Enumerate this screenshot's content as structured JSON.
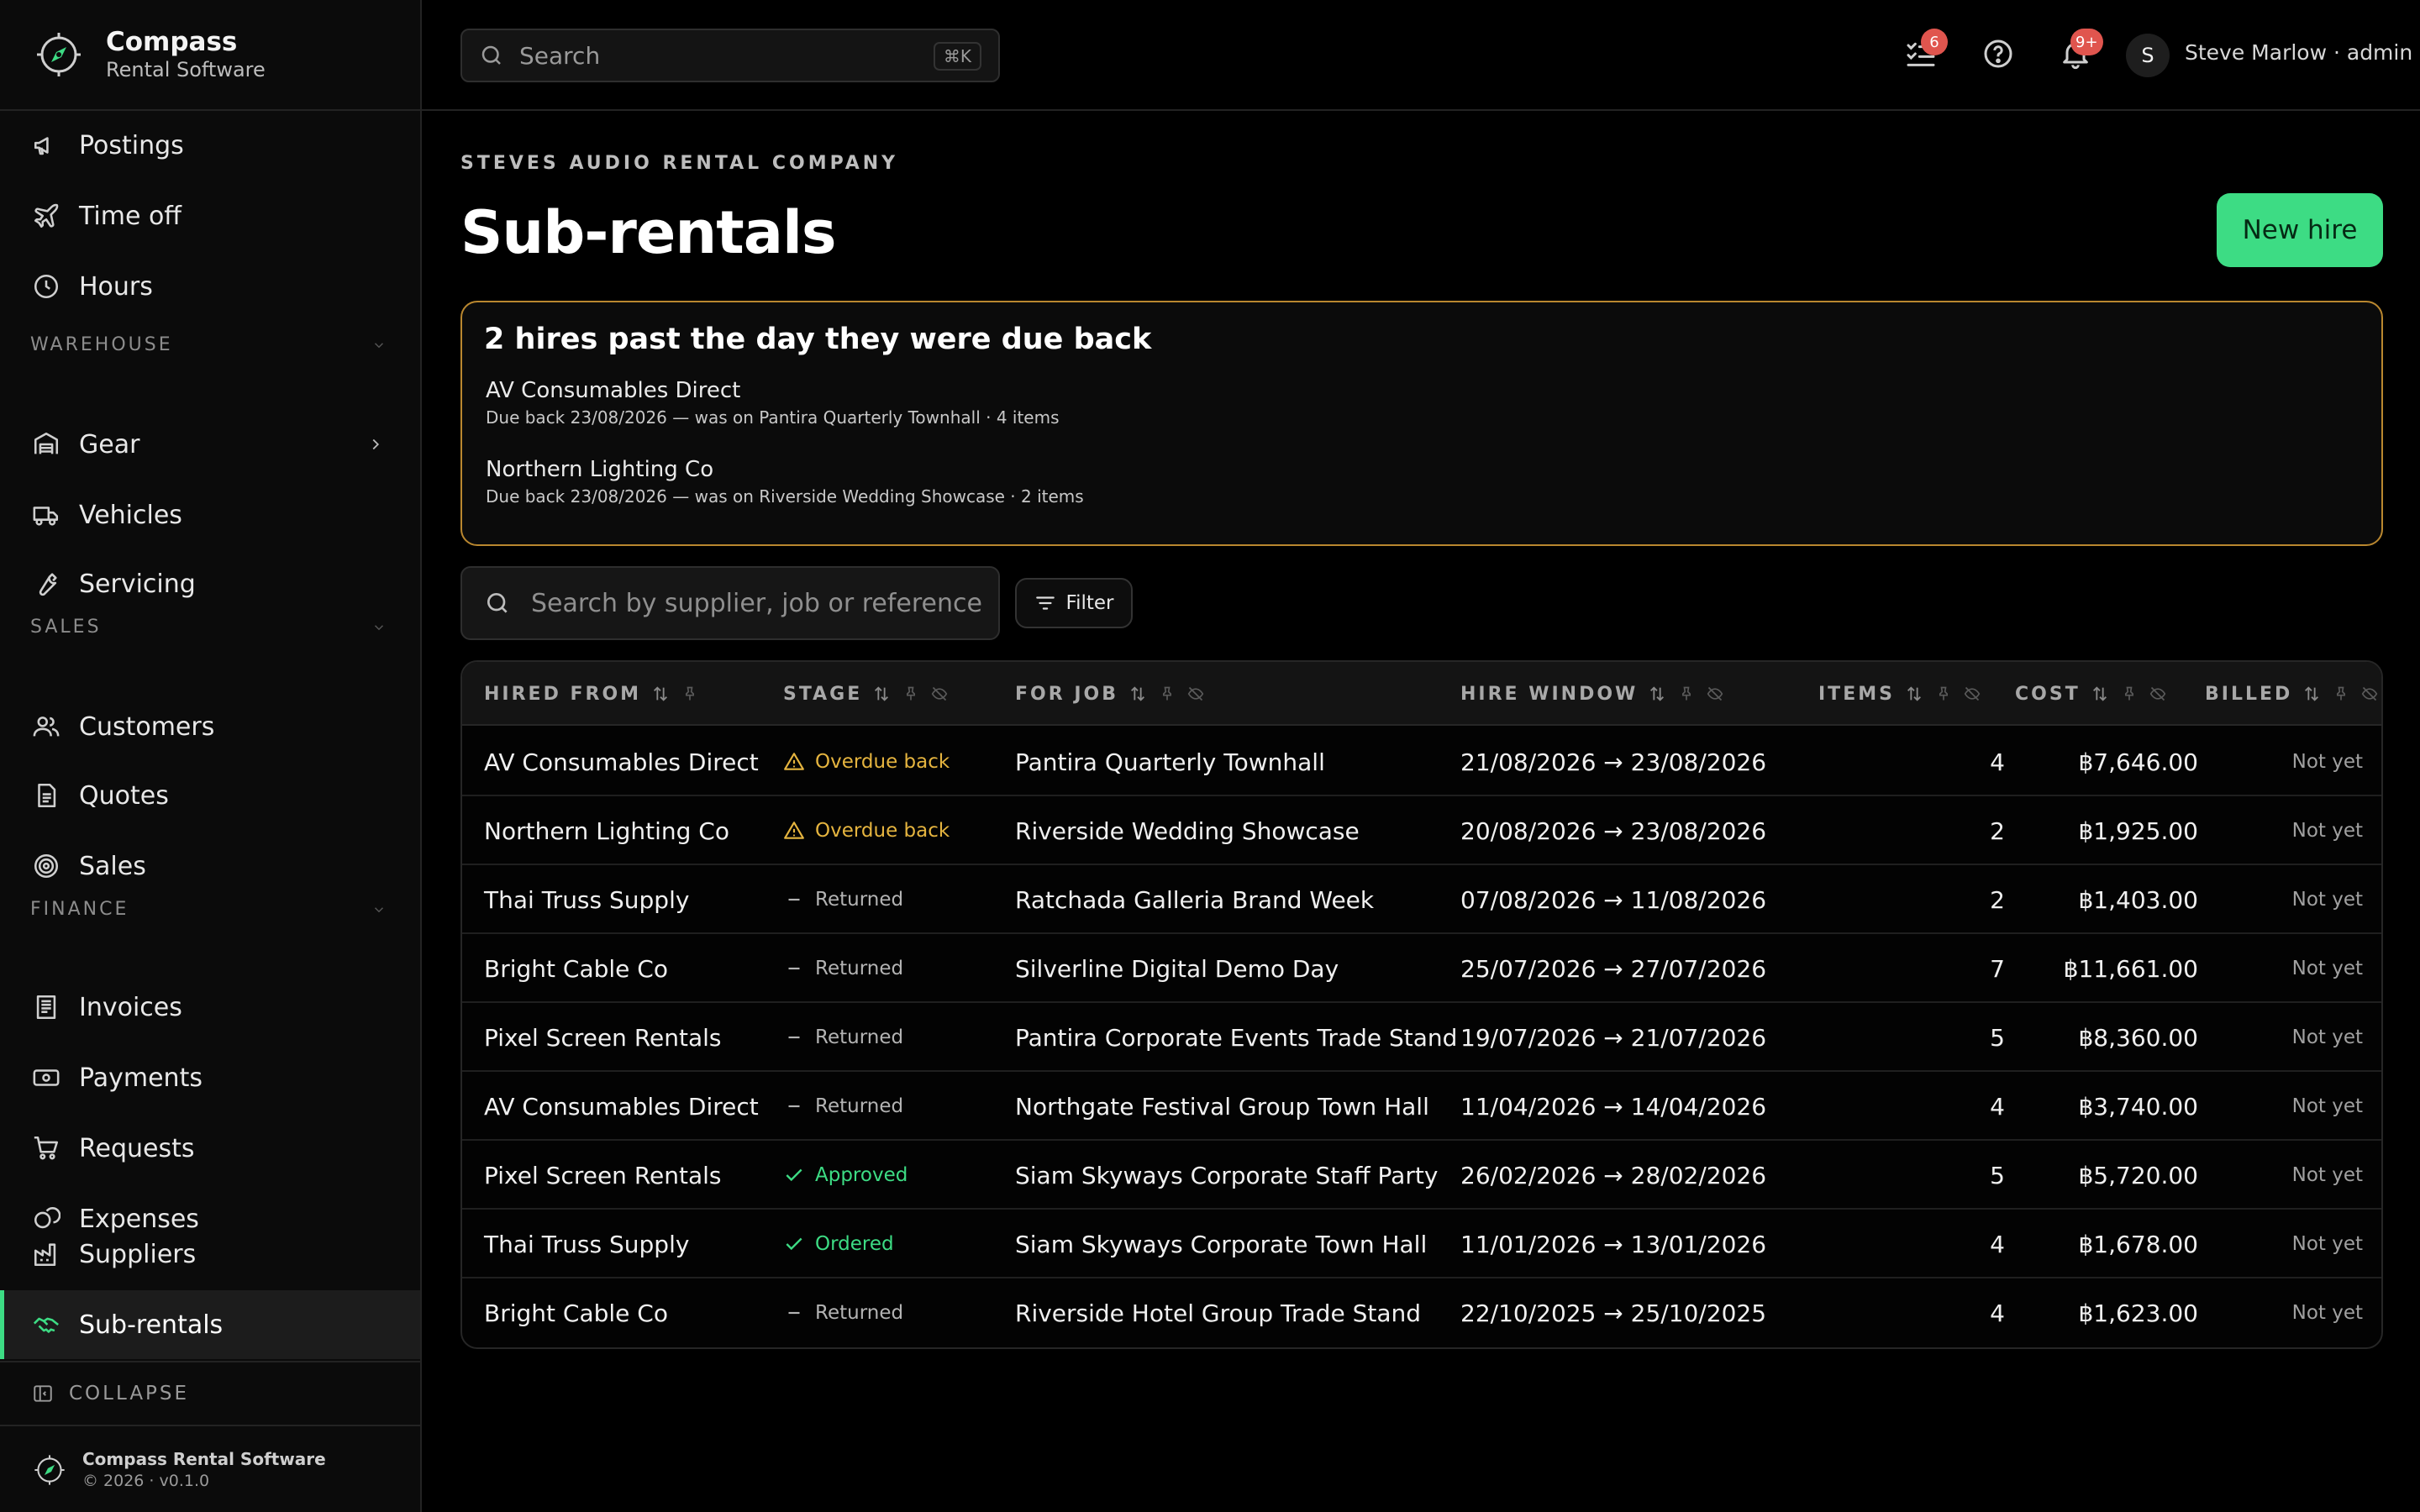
{
  "brand": {
    "name": "Compass",
    "subtitle": "Rental Software"
  },
  "nav": {
    "items": [
      {
        "label": "Postings",
        "icon": "megaphone-icon"
      },
      {
        "label": "Time off",
        "icon": "plane-icon"
      },
      {
        "label": "Hours",
        "icon": "clock-icon"
      },
      {
        "label": "Gear",
        "icon": "warehouse-icon"
      },
      {
        "label": "Vehicles",
        "icon": "truck-icon"
      },
      {
        "label": "Servicing",
        "icon": "wrench-icon"
      },
      {
        "label": "Customers",
        "icon": "users-icon"
      },
      {
        "label": "Quotes",
        "icon": "document-icon"
      },
      {
        "label": "Sales",
        "icon": "target-icon"
      },
      {
        "label": "Invoices",
        "icon": "receipt-icon"
      },
      {
        "label": "Payments",
        "icon": "banknote-icon"
      },
      {
        "label": "Requests",
        "icon": "cart-icon"
      },
      {
        "label": "Expenses",
        "icon": "coins-icon"
      },
      {
        "label": "Suppliers",
        "icon": "factory-icon"
      },
      {
        "label": "Sub-rentals",
        "icon": "handshake-icon"
      }
    ],
    "sections": {
      "warehouse": "WAREHOUSE",
      "sales": "SALES",
      "finance": "FINANCE"
    },
    "collapse": "COLLAPSE"
  },
  "footer": {
    "name": "Compass Rental Software",
    "version": "© 2026 · v0.1.0"
  },
  "topbar": {
    "search_placeholder": "Search",
    "shortcut": "⌘K",
    "tasks_badge": "6",
    "notifications_badge": "9+",
    "avatar_initial": "S",
    "user": "Steve Marlow · admin"
  },
  "page": {
    "company": "STEVES AUDIO RENTAL COMPANY",
    "title": "Sub-rentals",
    "new_button": "New hire"
  },
  "alert": {
    "heading": "2 hires past the day they were due back",
    "items": [
      {
        "name": "AV Consumables Direct",
        "detail": "Due back 23/08/2026 — was on Pantira Quarterly Townhall · 4 items"
      },
      {
        "name": "Northern Lighting Co",
        "detail": "Due back 23/08/2026 — was on Riverside Wedding Showcase · 2 items"
      }
    ]
  },
  "table_search": {
    "placeholder": "Search by supplier, job or reference…"
  },
  "filter_label": "Filter",
  "accent_color": "#3ddc84",
  "warning_color": "#e5b43f",
  "table": {
    "headers": {
      "hired_from": "HIRED FROM",
      "stage": "STAGE",
      "for_job": "FOR JOB",
      "hire_window": "HIRE WINDOW",
      "items": "ITEMS",
      "cost": "COST",
      "billed": "BILLED"
    },
    "rows": [
      {
        "supplier": "AV Consumables Direct",
        "stage": "Overdue back",
        "stage_type": "overdue",
        "job": "Pantira Quarterly Townhall",
        "window": "21/08/2026 → 23/08/2026",
        "items": "4",
        "cost": "฿7,646.00",
        "billed": "Not yet"
      },
      {
        "supplier": "Northern Lighting Co",
        "stage": "Overdue back",
        "stage_type": "overdue",
        "job": "Riverside Wedding Showcase",
        "window": "20/08/2026 → 23/08/2026",
        "items": "2",
        "cost": "฿1,925.00",
        "billed": "Not yet"
      },
      {
        "supplier": "Thai Truss Supply",
        "stage": "Returned",
        "stage_type": "returned",
        "job": "Ratchada Galleria Brand Week",
        "window": "07/08/2026 → 11/08/2026",
        "items": "2",
        "cost": "฿1,403.00",
        "billed": "Not yet"
      },
      {
        "supplier": "Bright Cable Co",
        "stage": "Returned",
        "stage_type": "returned",
        "job": "Silverline Digital Demo Day",
        "window": "25/07/2026 → 27/07/2026",
        "items": "7",
        "cost": "฿11,661.00",
        "billed": "Not yet"
      },
      {
        "supplier": "Pixel Screen Rentals",
        "stage": "Returned",
        "stage_type": "returned",
        "job": "Pantira Corporate Events Trade Stand",
        "window": "19/07/2026 → 21/07/2026",
        "items": "5",
        "cost": "฿8,360.00",
        "billed": "Not yet"
      },
      {
        "supplier": "AV Consumables Direct",
        "stage": "Returned",
        "stage_type": "returned",
        "job": "Northgate Festival Group Town Hall",
        "window": "11/04/2026 → 14/04/2026",
        "items": "4",
        "cost": "฿3,740.00",
        "billed": "Not yet"
      },
      {
        "supplier": "Pixel Screen Rentals",
        "stage": "Approved",
        "stage_type": "approved",
        "job": "Siam Skyways Corporate Staff Party",
        "window": "26/02/2026 → 28/02/2026",
        "items": "5",
        "cost": "฿5,720.00",
        "billed": "Not yet"
      },
      {
        "supplier": "Thai Truss Supply",
        "stage": "Ordered",
        "stage_type": "ordered",
        "job": "Siam Skyways Corporate Town Hall",
        "window": "11/01/2026 → 13/01/2026",
        "items": "4",
        "cost": "฿1,678.00",
        "billed": "Not yet"
      },
      {
        "supplier": "Bright Cable Co",
        "stage": "Returned",
        "stage_type": "returned",
        "job": "Riverside Hotel Group Trade Stand",
        "window": "22/10/2025 → 25/10/2025",
        "items": "4",
        "cost": "฿1,623.00",
        "billed": "Not yet"
      }
    ]
  }
}
